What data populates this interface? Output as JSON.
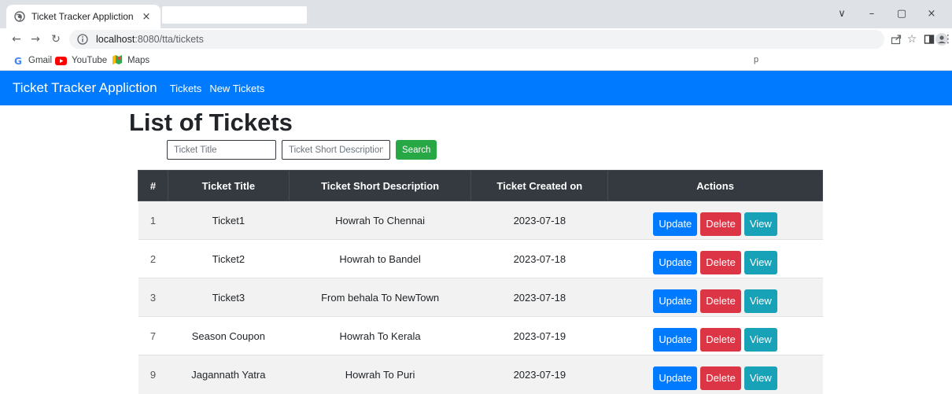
{
  "browser": {
    "tab_title": "Ticket Tracker Appliction",
    "tab_close": "×",
    "url_host": "localhost",
    "url_path": ":8080/tta/tickets",
    "window_controls": [
      "∨",
      "–",
      "▢",
      "×"
    ],
    "bookmarks": [
      {
        "label": "Gmail",
        "icon": "google-icon"
      },
      {
        "label": "YouTube",
        "icon": "youtube-icon"
      },
      {
        "label": "Maps",
        "icon": "maps-icon"
      }
    ],
    "bookmark_trailing": "p"
  },
  "navbar": {
    "brand": "Ticket Tracker Appliction",
    "links": [
      "Tickets",
      "New Tickets"
    ],
    "color": "#007bff"
  },
  "page": {
    "title": "List of Tickets",
    "search": {
      "title_placeholder": "Ticket Title",
      "description_placeholder": "Ticket Short Description",
      "button_label": "Search"
    }
  },
  "table": {
    "headers": [
      "#",
      "Ticket Title",
      "Ticket Short Description",
      "Ticket Created on",
      "Actions"
    ],
    "action_labels": {
      "update": "Update",
      "delete": "Delete",
      "view": "View"
    },
    "rows": [
      {
        "id": "1",
        "title": "Ticket1",
        "description": "Howrah To Chennai",
        "created": "2023-07-18"
      },
      {
        "id": "2",
        "title": "Ticket2",
        "description": "Howrah to Bandel",
        "created": "2023-07-18"
      },
      {
        "id": "3",
        "title": "Ticket3",
        "description": "From behala To NewTown",
        "created": "2023-07-18"
      },
      {
        "id": "7",
        "title": "Season Coupon",
        "description": "Howrah To Kerala",
        "created": "2023-07-19"
      },
      {
        "id": "9",
        "title": "Jagannath Yatra",
        "description": "Howrah To Puri",
        "created": "2023-07-19"
      }
    ]
  },
  "colors": {
    "update": "#007bff",
    "delete": "#dc3545",
    "view": "#17a2b8",
    "search": "#28a745",
    "table_header": "#343a40"
  }
}
